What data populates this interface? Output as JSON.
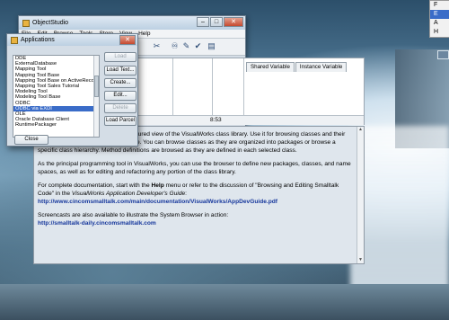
{
  "main_window": {
    "title": "ObjectStudio",
    "menu": [
      "File",
      "Edit",
      "Browse",
      "Tools",
      "Store",
      "View",
      "Help"
    ],
    "tabs": [
      "Shared Variable",
      "Instance Variable"
    ],
    "status_value": "8:53",
    "doc": {
      "p1": "The System Browser presents a structured view of the VisualWorks class library. Use it for browsing classes and their method definitions in the current image. You can browse classes as they are organized into packages or browse a specific class hierarchy. Method definitions are browsed as they are defined in each selected class.",
      "p2": "As the principal programming tool in VisualWorks, you can use the browser to define new packages, classes, and name spaces, as well as for editing and refactoring any portion of the class library.",
      "p3a": "For complete documentation, start with the",
      "p3_help": "Help",
      "p3b": "menu or refer to the discussion of \"Browsing and Editing Smalltalk Code\" in the",
      "p3_guide": "VisualWorks Application Developer's Guide",
      "link1": "http://www.cincomsmalltalk.com/main/documentation/VisualWorks/AppDevGuide.pdf",
      "p4": "Screencasts are also available to illustrate the System Browser in action:",
      "link2": "http://smalltalk-daily.cincomsmalltalk.com"
    }
  },
  "applications_dialog": {
    "title": "Applications",
    "items": [
      {
        "label": "DDE",
        "selected": false
      },
      {
        "label": "ExternalDatabase",
        "selected": false
      },
      {
        "label": "Mapping Tool",
        "selected": false
      },
      {
        "label": "Mapping Tool Base",
        "selected": false
      },
      {
        "label": "Mapping Tool Base on ActiveRecord",
        "selected": false
      },
      {
        "label": "Mapping Tool Sales Tutorial",
        "selected": false
      },
      {
        "label": "Modeling Tool",
        "selected": false
      },
      {
        "label": "Modeling Tool Base",
        "selected": false
      },
      {
        "label": "ODBC",
        "selected": false
      },
      {
        "label": "ODBC via EXDI",
        "selected": true
      },
      {
        "label": "OLE",
        "selected": false
      },
      {
        "label": "Oracle Database Client",
        "selected": false
      },
      {
        "label": "RuntimePackager",
        "selected": false
      }
    ],
    "buttons": {
      "load": "Load",
      "load_text": "Load Text...",
      "create": "Create...",
      "edit": "Edit...",
      "delete": "Delete",
      "load_parcel": "Load Parcel",
      "close": "Close"
    }
  },
  "edge_menu": [
    "F",
    "E",
    "A",
    "H"
  ],
  "colors": {
    "selection": "#3a6cc8",
    "link": "#16379c"
  }
}
